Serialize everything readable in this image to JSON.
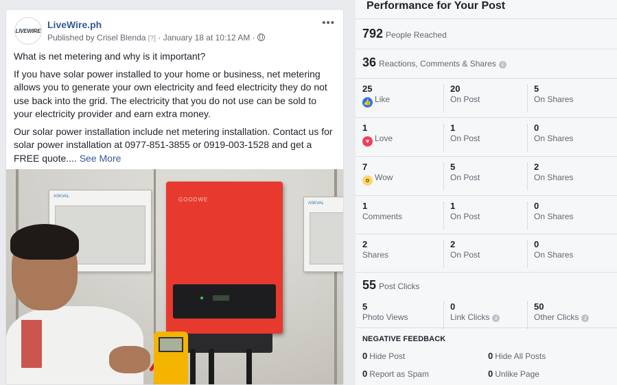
{
  "post": {
    "avatar_logo": "LIVEWIRE",
    "page_name": "LiveWire.ph",
    "published_by": "Published by Crisel Blenda",
    "help_marker": "[?]",
    "date": "· January 18 at 10:12 AM ·",
    "more_icon": "more-dots-icon",
    "paragraphs": [
      "What is net metering and why is it important?",
      "If you have solar power installed to your home or business, net metering allows you to generate your own electricity and feed electricity they do not use back into the grid. The electricity that you do not use can be sold to your electricity provider and earn extra money.",
      "Our solar power installation include net metering installation. Contact us for solar power installation at 0977-851-3855 or 0919-003-1528 and get a FREE quote...."
    ],
    "see_more": "See More"
  },
  "performance": {
    "title": "Performance for Your Post",
    "reached": {
      "value": "792",
      "label": "People Reached"
    },
    "engagement": {
      "value": "36",
      "label": "Reactions, Comments & Shares"
    },
    "rows": [
      {
        "icon": "like-icon",
        "value": "25",
        "label": "Like",
        "on_post": "20",
        "on_post_label": "On Post",
        "on_shares": "5",
        "on_shares_label": "On Shares"
      },
      {
        "icon": "love-icon",
        "value": "1",
        "label": "Love",
        "on_post": "1",
        "on_post_label": "On Post",
        "on_shares": "0",
        "on_shares_label": "On Shares"
      },
      {
        "icon": "wow-icon",
        "value": "7",
        "label": "Wow",
        "on_post": "5",
        "on_post_label": "On Post",
        "on_shares": "2",
        "on_shares_label": "On Shares"
      },
      {
        "value": "1",
        "label": "Comments",
        "on_post": "1",
        "on_post_label": "On Post",
        "on_shares": "0",
        "on_shares_label": "On Shares"
      },
      {
        "value": "2",
        "label": "Shares",
        "on_post": "2",
        "on_post_label": "On Post",
        "on_shares": "0",
        "on_shares_label": "On Shares"
      }
    ],
    "clicks": {
      "value": "55",
      "label": "Post Clicks",
      "photo_views": "5",
      "photo_views_label": "Photo Views",
      "link_clicks": "0",
      "link_clicks_label": "Link Clicks",
      "other_clicks": "50",
      "other_clicks_label": "Other Clicks"
    },
    "negative": {
      "title": "NEGATIVE FEEDBACK",
      "hide_post": {
        "value": "0",
        "label": "Hide Post"
      },
      "hide_all": {
        "value": "0",
        "label": "Hide All Posts"
      },
      "spam": {
        "value": "0",
        "label": "Report as Spam"
      },
      "unlike": {
        "value": "0",
        "label": "Unlike Page"
      }
    }
  },
  "colors": {
    "link": "#365899",
    "like": "#2078f4",
    "love": "#f33e58",
    "wow": "#fcd86a",
    "inverter": "#e8392e"
  }
}
